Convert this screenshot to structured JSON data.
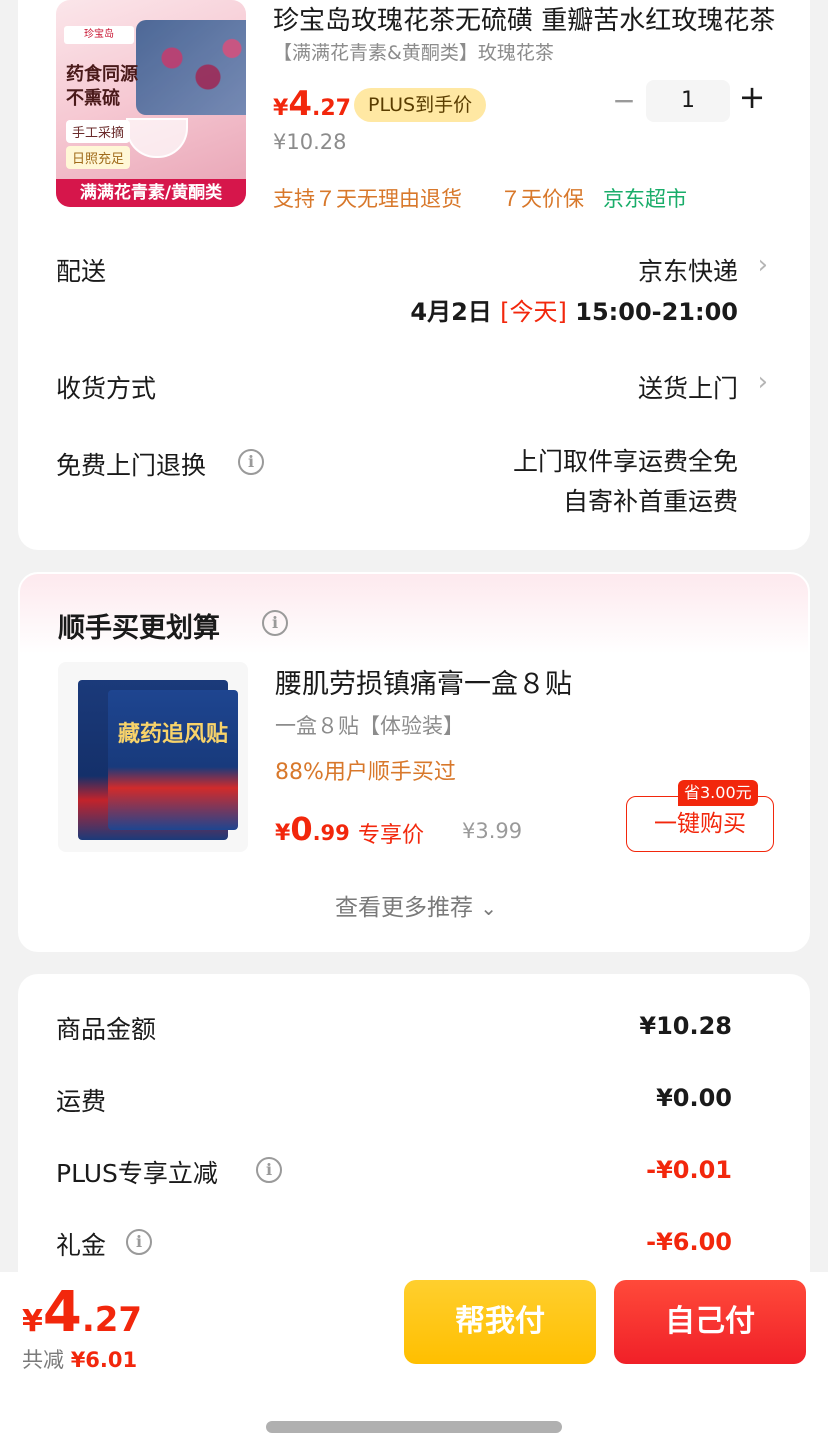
{
  "product": {
    "image_texts": [
      "珍宝岛",
      "药食同源",
      "不熏硫",
      "手工采摘",
      "日照充足",
      "满满花青素/黄酮类"
    ],
    "title": "珍宝岛玫瑰花茶无硫磺 重瓣苦水红玫瑰花茶",
    "spec": "【满满花青素&黄酮类】玫瑰花茶",
    "price_symbol": "¥",
    "price_int": "4",
    "price_dec": ".27",
    "plus_tag": "PLUS到手价",
    "orig_price": "¥10.28",
    "qty_minus": "−",
    "qty": "1",
    "qty_plus": "+",
    "service": [
      "支持７天无理由退货",
      "７天价保",
      "京东超市"
    ]
  },
  "delivery": {
    "label": "配送",
    "carrier": "京东快递",
    "date": "4月2日",
    "today": "[今天]",
    "time": "15:00-21:00"
  },
  "receive": {
    "label": "收货方式",
    "value": "送货上门"
  },
  "free_return": {
    "label": "免费上门退换",
    "line1": "上门取件享运费全免",
    "line2": "自寄补首重运费"
  },
  "recommend": {
    "title": "顺手买更划算",
    "image_text": "藏药追风贴",
    "name": "腰肌劳损镇痛膏一盒８贴",
    "spec": "一盒８贴【体验装】",
    "buyers": "88%用户顺手买过",
    "price_symbol": "¥",
    "price_int": "0",
    "price_dec": ".99",
    "exclusive": "专享价",
    "orig_price": "¥3.99",
    "save_badge": "省3.00元",
    "buy_label": "一键购买",
    "more": "查看更多推荐"
  },
  "summary": {
    "rows": [
      {
        "label": "商品金额",
        "value": "¥10.28"
      },
      {
        "label": "运费",
        "value": "¥0.00"
      },
      {
        "label": "PLUS专享立减",
        "value": "-¥0.01"
      },
      {
        "label": "礼金",
        "value": "-¥6.00"
      }
    ]
  },
  "bottom": {
    "price_symbol": "¥",
    "price_int": "4",
    "price_dec": ".27",
    "save_label": "共减",
    "save_value": "¥6.01",
    "help_pay": "帮我付",
    "self_pay": "自己付"
  },
  "colors": {
    "accent_red": "#f2270c",
    "orange": "#d8782b",
    "green": "#1aad6a",
    "plus_gold": "#ffe8a3",
    "help_yellow": "#ffc000"
  }
}
